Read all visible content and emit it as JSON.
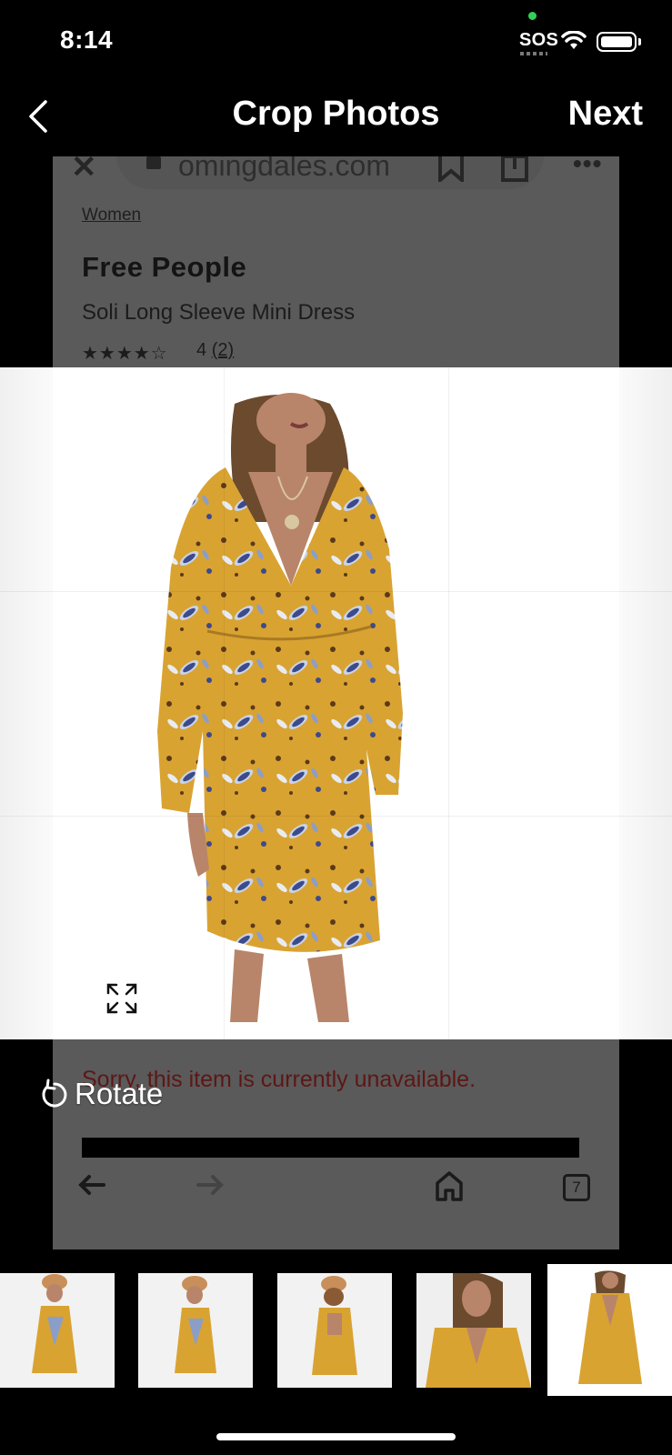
{
  "status": {
    "time": "8:14",
    "carrier": "SOS"
  },
  "nav": {
    "title": "Crop Photos",
    "next_label": "Next",
    "back_icon": "chevron-left-icon"
  },
  "screenshot": {
    "url": "bloomingdales.com",
    "url_visible": "omingdales.com",
    "breadcrumb": "Women",
    "brand": "Free People",
    "product_name": "Soli Long Sleeve Mini Dress",
    "stars": "★★★★☆",
    "rating_value": "4",
    "rating_count": "(2)",
    "unavailable_text": "Sorry, this item is currently unavailable.",
    "tab_count": "7"
  },
  "crop": {
    "expand_icon": "expand-icon"
  },
  "toolbar": {
    "rotate_label": "Rotate"
  },
  "colors": {
    "dress_base": "#d9a332",
    "dress_pattern": "#3d4a8c",
    "dimmed": "#5a5a5a",
    "accent_green": "#30d158"
  }
}
